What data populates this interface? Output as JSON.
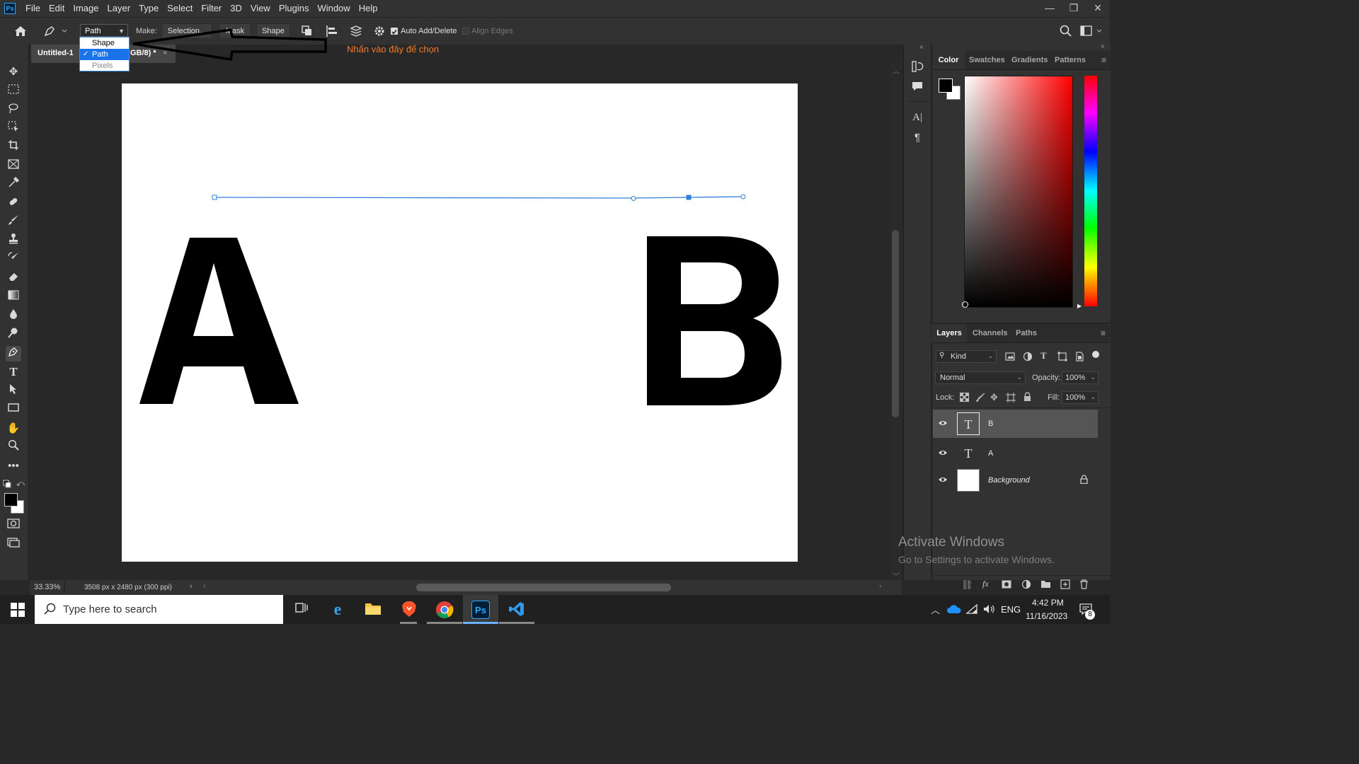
{
  "menubar": {
    "logo": "Ps",
    "items": [
      "File",
      "Edit",
      "Image",
      "Layer",
      "Type",
      "Select",
      "Filter",
      "3D",
      "View",
      "Plugins",
      "Window",
      "Help"
    ],
    "window_controls": [
      "—",
      "❐",
      "✕"
    ]
  },
  "options": {
    "mode_value": "Path",
    "make_label": "Make:",
    "selection_button": "Selection...",
    "mask_button": "Mask",
    "shape_button": "Shape",
    "auto_add_delete": "Auto Add/Delete",
    "auto_add_delete_checked": true,
    "align_edges": "Align Edges",
    "align_edges_checked": false
  },
  "mode_dropdown": {
    "options": [
      "Shape",
      "Path",
      "Pixels"
    ],
    "selected": "Path"
  },
  "annotation": {
    "text": "Nhấn vào đây để chọn",
    "color": "#f07a2a"
  },
  "document": {
    "tab_title": "Untitled-1",
    "tab_suffix": "GB/8) *",
    "canvas_letters": [
      "A",
      "B"
    ],
    "path_color": "#2f7fd8"
  },
  "statusbar": {
    "zoom": "33.33%",
    "doc_info": "3508 px x 2480 px (300 ppi)"
  },
  "color_panel": {
    "tabs": [
      "Color",
      "Swatches",
      "Gradients",
      "Patterns"
    ],
    "active_tab": "Color",
    "foreground": "#000000",
    "background": "#ffffff"
  },
  "layers_panel": {
    "tabs": [
      "Layers",
      "Channels",
      "Paths"
    ],
    "active_tab": "Layers",
    "filter_kind": "Kind",
    "blend_mode": "Normal",
    "opacity_label": "Opacity:",
    "opacity": "100%",
    "lock_label": "Lock:",
    "fill_label": "Fill:",
    "fill": "100%",
    "layers": [
      {
        "name": "B",
        "type": "text",
        "selected": true
      },
      {
        "name": "A",
        "type": "text",
        "selected": false
      },
      {
        "name": "Background",
        "type": "image",
        "selected": false,
        "locked": true
      }
    ]
  },
  "watermark": {
    "line1": "Activate Windows",
    "line2": "Go to Settings to activate Windows."
  },
  "taskbar": {
    "search_placeholder": "Type here to search",
    "language": "ENG",
    "time": "4:42 PM",
    "date": "11/16/2023",
    "notification_count": "8"
  }
}
